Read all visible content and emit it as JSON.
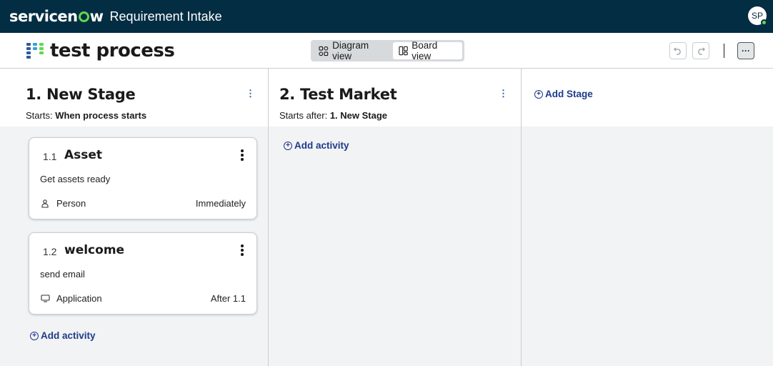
{
  "banner": {
    "logo_pre": "servicen",
    "logo_post": "w",
    "app_title": "Requirement Intake",
    "avatar_initials": "SP"
  },
  "toolbar": {
    "process_title": "test process",
    "views": [
      {
        "label": "Diagram view",
        "icon": "diagram-icon",
        "active": false
      },
      {
        "label": "Board view",
        "icon": "board-icon",
        "active": true
      }
    ],
    "more_label": "···"
  },
  "stages": [
    {
      "title": "1. New Stage",
      "starts_prefix": "Starts: ",
      "starts_value": "When process starts",
      "activities": [
        {
          "num": "1.1",
          "title": "Asset",
          "desc": "Get assets ready",
          "assignee": "Person",
          "assignee_icon": "person-icon",
          "when": "Immediately"
        },
        {
          "num": "1.2",
          "title": "welcome",
          "desc": "send email",
          "assignee": "Application",
          "assignee_icon": "application-icon",
          "when": "After 1.1"
        }
      ],
      "add_activity_label": "Add activity"
    },
    {
      "title": "2. Test Market",
      "starts_prefix": "Starts after: ",
      "starts_value": "1. New Stage",
      "activities": [],
      "add_activity_label": "Add activity"
    }
  ],
  "add_stage_label": "Add Stage",
  "colors": {
    "banner": "#032d42",
    "accent_green": "#62d84e",
    "link_blue": "#1e3a8a"
  }
}
